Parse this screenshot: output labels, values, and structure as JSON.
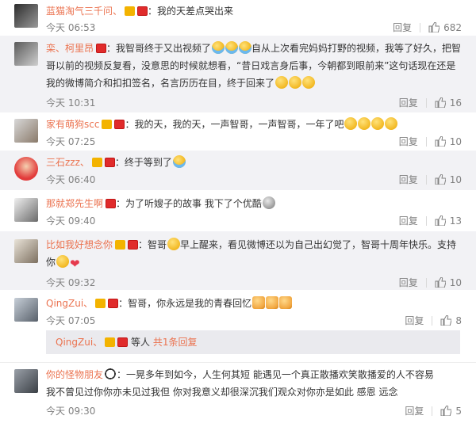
{
  "comments": [
    {
      "user": "蓝猫淘气三千问、",
      "text": "：我的天差点哭出来",
      "time": "今天 06:53",
      "reply_label": "回复",
      "likes": "682"
    },
    {
      "user": "栾、柯里昂",
      "text_part1": "：我智哥终于又出视频了",
      "text_part2": "自从上次看完妈妈打野的视频，我等了好久，把智哥以前的视频反复看，没意思的时候就想看，“昔日戏言身后事，今朝都到眼前来”这句话现在还是我的微博简介和扣扣签名，名言历历在目，终于回来了",
      "time": "今天 10:31",
      "reply_label": "回复",
      "likes": "16"
    },
    {
      "user": "家有萌狗scc",
      "text": "：我的天，我的天，一声智哥，一声智哥，一年了吧",
      "time": "今天 07:25",
      "reply_label": "回复",
      "likes": "10"
    },
    {
      "user": "三石zzz、",
      "text": "：终于等到了",
      "time": "今天 06:40",
      "reply_label": "回复",
      "likes": "10"
    },
    {
      "user": "那就郑先生啊",
      "text": "：为了听嫂子的故事 我下了个优酷",
      "time": "今天 09:40",
      "reply_label": "回复",
      "likes": "13"
    },
    {
      "user": "比如我好想念你",
      "text_part1": "：智哥",
      "text_part2": "早上醒来，看见微博还以为自己出幻觉了，智哥十周年快乐。支持你",
      "time": "今天 09:32",
      "reply_label": "回复",
      "likes": "10"
    },
    {
      "user": "QingZui、",
      "text": "：智哥，你永远是我的青春回忆",
      "time": "今天 07:05",
      "reply_label": "回复",
      "likes": "8",
      "sub_user": "QingZui、",
      "sub_text": "等人",
      "sub_link": "共1条回复"
    },
    {
      "user": "你的怪物朋友",
      "text_part1": "：一晃多年到如今，人生何其短  能遇见一个真正散播欢笑散播爱的人不容易",
      "text_part2": "我不曾见过你你亦未见过我但 你对我意义却很深沉我们观众对你亦是如此 感恩 远念",
      "time": "今天 09:30",
      "reply_label": "回复",
      "likes": "5"
    }
  ],
  "colors": {
    "username": "#eb7350",
    "meta": "#808080",
    "alt_row": "#f2f2f5"
  }
}
